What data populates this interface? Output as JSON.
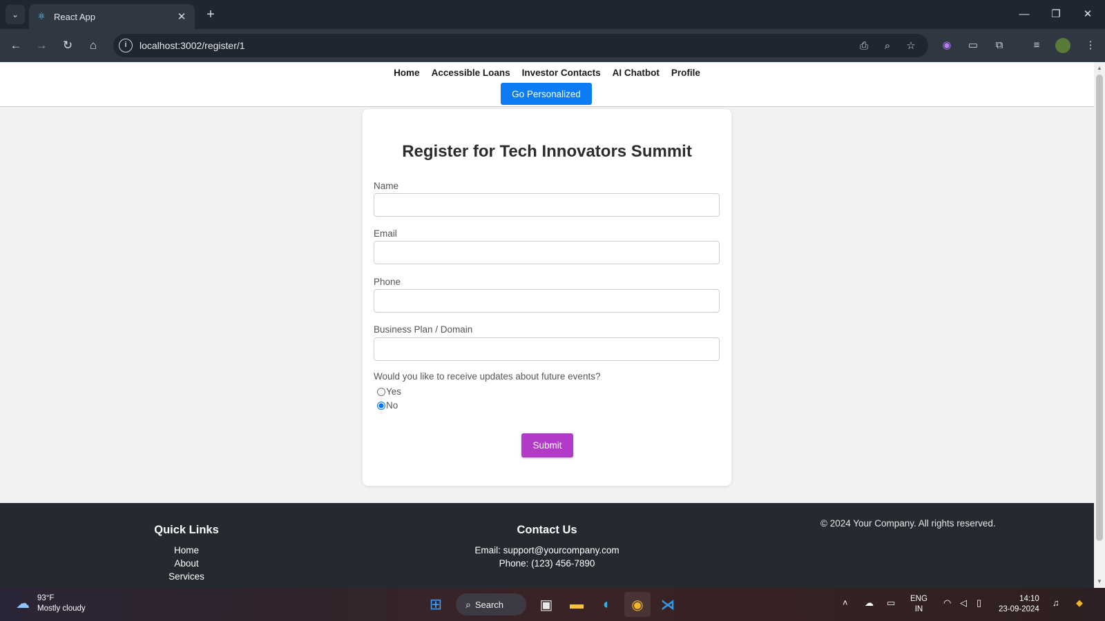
{
  "browser": {
    "tab_title": "React App",
    "url": "localhost:3002/register/1",
    "new_tab_symbol": "+"
  },
  "site": {
    "nav": [
      "Home",
      "Accessible Loans",
      "Investor Contacts",
      "AI Chatbot",
      "Profile"
    ],
    "go_personalized": "Go Personalized"
  },
  "form": {
    "title": "Register for Tech Innovators Summit",
    "fields": [
      {
        "label": "Name",
        "value": "",
        "placeholder": ""
      },
      {
        "label": "Email",
        "value": "",
        "placeholder": ""
      },
      {
        "label": "Phone",
        "value": "",
        "placeholder": ""
      },
      {
        "label": "Business Plan / Domain",
        "value": "",
        "placeholder": ""
      }
    ],
    "question": "Would you like to receive updates about future events?",
    "options": [
      {
        "label": "Yes",
        "checked": false
      },
      {
        "label": "No",
        "checked": true
      }
    ],
    "submit": "Submit"
  },
  "footer": {
    "quick_links_title": "Quick Links",
    "links": [
      "Home",
      "About",
      "Services"
    ],
    "contact_title": "Contact Us",
    "email": "Email: support@yourcompany.com",
    "phone": "Phone: (123) 456-7890",
    "copyright": "© 2024 Your Company. All rights reserved."
  },
  "taskbar": {
    "temp": "93°F",
    "weather": "Mostly cloudy",
    "search": "Search",
    "lang": "ENG",
    "region": "IN",
    "time": "14:10",
    "date": "23-09-2024"
  },
  "colors": {
    "go_button": "#0d7cf2",
    "submit_button": "#b13bc7",
    "footer_bg": "#252a30"
  }
}
